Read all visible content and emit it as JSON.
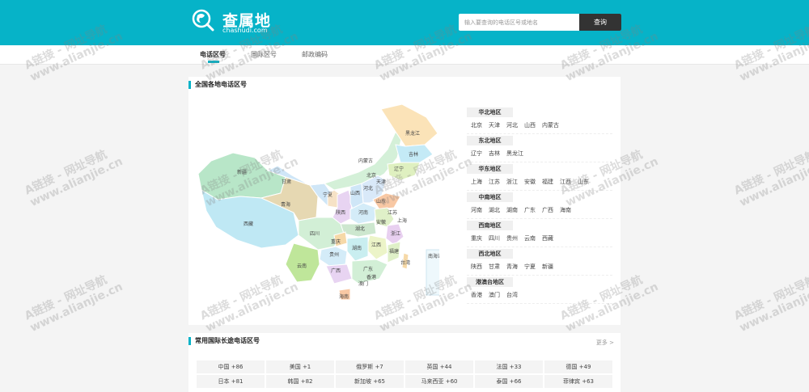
{
  "header": {
    "logo_text": "查属地",
    "logo_sub": "chashudi.com",
    "search_placeholder": "输入要查询的电话区号或地名",
    "search_button": "查询"
  },
  "nav": {
    "tabs": [
      "电话区号",
      "国际区号",
      "邮政编码"
    ]
  },
  "section1": {
    "title": "全国各地电话区号"
  },
  "map_labels": [
    "黑龙江",
    "吉林",
    "辽宁",
    "内蒙古",
    "新疆",
    "甘肃",
    "北京",
    "天津",
    "河北",
    "山西",
    "宁夏",
    "青海",
    "陕西",
    "河南",
    "山东",
    "江苏",
    "上海",
    "安徽",
    "湖北",
    "西藏",
    "四川",
    "重庆",
    "浙江",
    "江西",
    "贵州",
    "湖南",
    "福建",
    "台湾",
    "云南",
    "广西",
    "广东",
    "香港",
    "澳门",
    "海南",
    "南海诸岛"
  ],
  "regions": [
    {
      "name": "华北地区",
      "items": [
        "北京",
        "天津",
        "河北",
        "山西",
        "内蒙古"
      ]
    },
    {
      "name": "东北地区",
      "items": [
        "辽宁",
        "吉林",
        "黑龙江"
      ]
    },
    {
      "name": "华东地区",
      "items": [
        "上海",
        "江苏",
        "浙江",
        "安徽",
        "福建",
        "江西",
        "山东"
      ]
    },
    {
      "name": "中南地区",
      "items": [
        "河南",
        "湖北",
        "湖南",
        "广东",
        "广西",
        "海南"
      ]
    },
    {
      "name": "西南地区",
      "items": [
        "重庆",
        "四川",
        "贵州",
        "云南",
        "西藏"
      ]
    },
    {
      "name": "西北地区",
      "items": [
        "陕西",
        "甘肃",
        "青海",
        "宁夏",
        "新疆"
      ]
    },
    {
      "name": "港澳台地区",
      "items": [
        "香港",
        "澳门",
        "台湾"
      ]
    }
  ],
  "section2": {
    "title": "常用国际长途电话区号",
    "more": "更多 >"
  },
  "intl_codes": [
    "中国 +86",
    "美国 +1",
    "俄罗斯 +7",
    "英国 +44",
    "法国 +33",
    "德国 +49",
    "日本 +81",
    "韩国 +82",
    "新加坡 +65",
    "马来西亚 +60",
    "泰国 +66",
    "菲律宾 +63"
  ],
  "watermark": [
    "A链接 - 网址导航",
    "www.alianjie.cn"
  ],
  "colors": {
    "accent": "#06b3c8",
    "button": "#333333"
  }
}
